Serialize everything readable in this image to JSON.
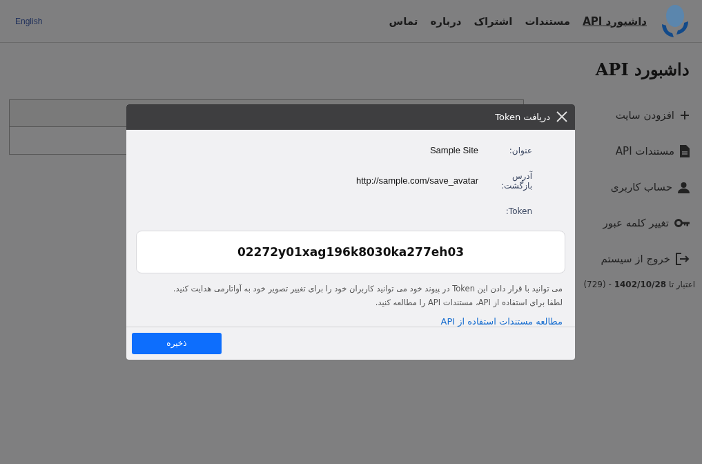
{
  "header": {
    "nav": [
      {
        "label": "داشبورد API",
        "selected": true
      },
      {
        "label": "مستندات",
        "selected": false
      },
      {
        "label": "اشتراک",
        "selected": false
      },
      {
        "label": "درباره",
        "selected": false
      },
      {
        "label": "تماس",
        "selected": false
      }
    ],
    "language": "English"
  },
  "page_title": "داشبورد API",
  "sidebar": {
    "items": [
      {
        "label": "افزودن سایت",
        "kind": "plus"
      },
      {
        "label": "مستندات API",
        "kind": "doc"
      },
      {
        "label": "حساب کاربری",
        "kind": "user"
      },
      {
        "label": "تغییر کلمه عبور",
        "kind": "key"
      },
      {
        "label": "خروج از سیستم",
        "kind": "logout"
      }
    ],
    "validity": "اعتبار تا **1402/10/28** - (729)"
  },
  "modal": {
    "title": "دریافت Token",
    "fields": [
      {
        "label": "عنوان:",
        "value": "Sample Site"
      },
      {
        "label": "آدرس بازگشت:",
        "value": "http://sample.com/save_avatar"
      }
    ],
    "token_label": "Token:",
    "token": "02272y01xag196k8030ka277eh03",
    "description": [
      "می توانید با قرار دادن این Token در پیوند خود می توانید کاربران خود را برای تغییر تصویر خود به آواتارمی هدایت کنید.",
      "لطفا برای استفاده از API، مستندات API را مطالعه کنید."
    ],
    "link": "مطالعه مستندات استفاده از API",
    "save_button": "ذخیره"
  }
}
